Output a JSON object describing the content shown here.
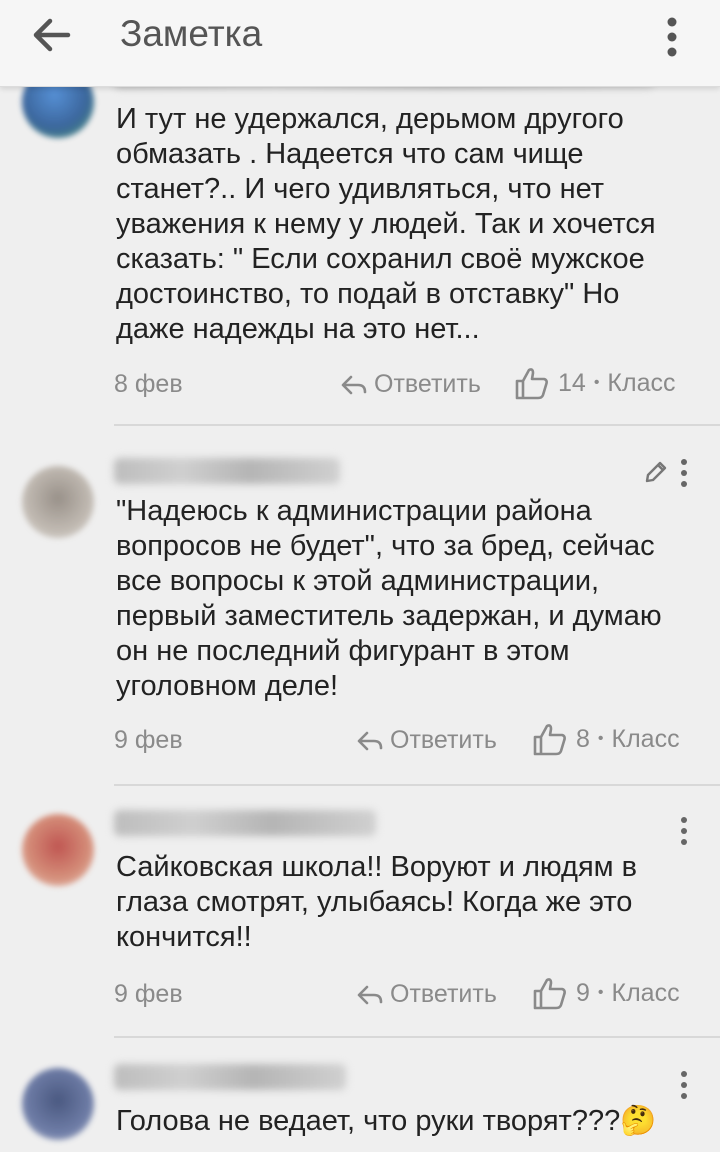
{
  "header": {
    "title": "Заметка",
    "back_icon": "arrow-left-icon",
    "menu_icon": "more-vert-icon"
  },
  "comments": [
    {
      "text": "И тут не удержался, дерьмом другого обмазать . Надеется что сам чище станет?.. И чего удивляться, что нет уважения к нему у людей. Так и хочется сказать: \" Если сохранил своё мужское достоинство, то подай в отставку\" Но даже надежды на это нет...",
      "date": "8 фев",
      "reply": "Ответить",
      "likes": "14",
      "klass": "Класс"
    },
    {
      "text": "\"Надеюсь к администрации района вопросов не будет\", что за бред, сейчас все вопросы к этой администрации, первый заместитель задержан, и думаю он не последний фигурант в этом уголовном деле!",
      "date": "9 фев",
      "reply": "Ответить",
      "likes": "8",
      "klass": "Класс"
    },
    {
      "text": "Сайковская школа!! Воруют и людям в глаза смотрят, улыбаясь! Когда же это кончится!!",
      "date": "9 фев",
      "reply": "Ответить",
      "likes": "9",
      "klass": "Класс"
    },
    {
      "text": "Голова не ведает, что руки творят???🤔"
    }
  ],
  "separator": "•"
}
